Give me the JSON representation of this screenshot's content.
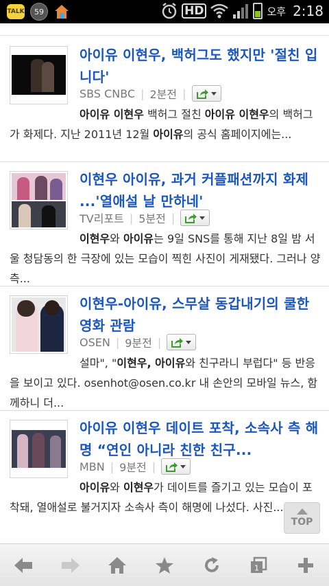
{
  "status_bar": {
    "talk_label": "TALK",
    "badge_count": "59",
    "hd_label": "HD",
    "ampm": "오후",
    "time": "2:18"
  },
  "articles": [
    {
      "title": "아이유 이현우, 백허그도 했지만 '절친 입니다'",
      "source": "SBS CNBC",
      "time": "2분전",
      "snippet_parts": [
        "아이유 이현우",
        " 백허그 절친 ",
        "아이유 이현우",
        "의 백허그가 화제다. 지난 2011년 12월 ",
        "아이유",
        "의 공식 홈페이지에는..."
      ]
    },
    {
      "title": "이현우 아이유, 과거 커플패션까지 화제 ...'열애설 날 만하네'",
      "source": "TV리포트",
      "time": "5분전",
      "snippet_parts": [
        "이현우",
        "와 ",
        "아이유",
        "는 9일 SNS를 통해 지난 8일 밤 서울 청담동의 한 극장에 있는 모습이 찍힌 사진이 게재됐다. 그러나 양측...",
        "",
        ""
      ]
    },
    {
      "title": "이현우-아이유, 스무살 동갑내기의 쿨한 영화 관람",
      "source": "OSEN",
      "time": "9분전",
      "snippet_parts": [
        "",
        "설마\", \"",
        "이현우, 아이유",
        "와 친구라니 부럽다\" 등 반응을 보이고 있다. osenhot@osen.co.kr 내 손안의 모바일 뉴스, 함께하니 더...",
        "",
        ""
      ]
    },
    {
      "title": "아이유 이현우 데이트 포착, 소속사 측 해명 “연인 아니라 친한 친구...",
      "source": "MBN",
      "time": "9분전",
      "snippet_parts": [
        "아이유",
        "와 ",
        "이현우",
        "가 데이트를 즐기고 있는 모습이 포착돼, 열애설로 불거지자 소속사 측이 해명에 나섰다. 사진...",
        "",
        ""
      ]
    }
  ],
  "top_button_label": "TOP",
  "toolbar": {
    "items": [
      "back-icon",
      "forward-icon",
      "home-icon",
      "bookmark-star-icon",
      "refresh-icon",
      "tabs-icon",
      "add-icon"
    ],
    "tab_count": "1"
  },
  "colors": {
    "title_blue": "#1a56c0",
    "meta_gray": "#777777",
    "share_green": "#3d9a2f"
  }
}
